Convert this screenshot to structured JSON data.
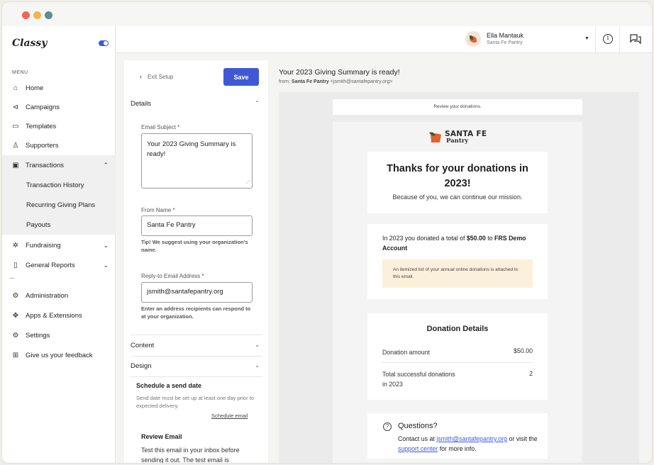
{
  "app": {
    "logo": "Classy",
    "toggle_on": true
  },
  "sidebar": {
    "menu_label": "MENU",
    "items": [
      {
        "label": "Home",
        "icon": "home-icon"
      },
      {
        "label": "Campaigns",
        "icon": "megaphone-icon"
      },
      {
        "label": "Templates",
        "icon": "template-icon"
      },
      {
        "label": "Supporters",
        "icon": "supporters-icon"
      },
      {
        "label": "Transactions",
        "icon": "transactions-icon",
        "expanded": true
      },
      {
        "label": "Transaction History"
      },
      {
        "label": "Recurring Giving Plans"
      },
      {
        "label": "Payouts"
      },
      {
        "label": "Fundraising",
        "icon": "fundraising-icon"
      },
      {
        "label": "General Reports",
        "icon": "report-icon"
      },
      {
        "label": "Administration",
        "icon": "admin-icon"
      },
      {
        "label": "Apps & Extensions",
        "icon": "puzzle-icon"
      },
      {
        "label": "Settings",
        "icon": "gear-icon"
      },
      {
        "label": "Give us your feedback",
        "icon": "feedback-icon"
      }
    ]
  },
  "header": {
    "user_name": "Ella Mantauk",
    "user_org": "Santa Fe Pantry"
  },
  "setup": {
    "exit_label": "Exit Setup",
    "save_label": "Save",
    "details_label": "Details",
    "subject_label": "Email Subject *",
    "subject_value": "Your 2023 Giving Summary is ready!",
    "from_name_label": "From Name *",
    "from_name_value": "Santa Fe Pantry",
    "from_name_tip": "Tip! We suggest using your organization's name.",
    "reply_label": "Reply-to Email Address *",
    "reply_value": "jsmith@santafepantry.org",
    "reply_tip": "Enter an address recipients can respond to at your organization.",
    "content_label": "Content",
    "design_label": "Design",
    "schedule_title": "Schedule a send date",
    "schedule_text": "Send date must be set up at least one day prior to expected delivery.",
    "schedule_link": "Schedule email",
    "review_title": "Review Email",
    "review_text": "Test this email in your inbox before sending it out. The test email is"
  },
  "preview": {
    "subject": "Your 2023 Giving Summary is ready!",
    "from_prefix": "from:",
    "from_name": "Santa Fe Pantry",
    "from_email": "<jsmith@santafepantry.org>",
    "review_bar": "Review your donations.",
    "brand_name": "SANTA FE",
    "brand_sub": "Pantry",
    "thanks_title": "Thanks for your donations in 2023!",
    "thanks_sub": "Because of you, we can continue our mission.",
    "total_prefix": "In 2023 you donated a total of",
    "total_amount": "$50.00",
    "total_to": "to",
    "total_account": "FRS Demo Account",
    "note": "An itemized list of your annual online donations is attached to this email.",
    "details_title": "Donation Details",
    "donation_amount_label": "Donation amount",
    "donation_amount_value": "$50.00",
    "total_successful_label": "Total successful donations in 2023",
    "total_successful_value": "2",
    "questions_title": "Questions?",
    "questions_prefix": "Contact us at",
    "questions_email": "jsmith@santafepantry.org",
    "questions_mid": "or visit the",
    "questions_link": "support center",
    "questions_suffix": "for more info."
  },
  "colors": {
    "accent": "#3f59d6",
    "note_bg": "#fbf0db",
    "brand_orange": "#e0622f",
    "brand_green": "#3e5a2e"
  }
}
